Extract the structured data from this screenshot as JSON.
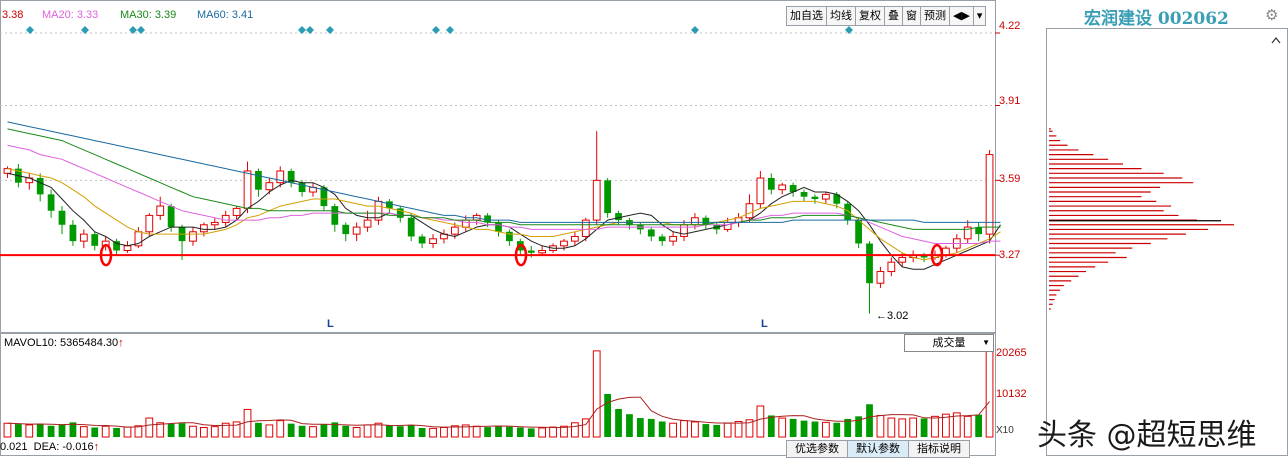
{
  "stock": {
    "name": "宏润建设 002062"
  },
  "toolbar": {
    "items": [
      "加自选",
      "均线",
      "复权",
      "叠",
      "窗",
      "预测",
      "◀▶",
      "▾"
    ]
  },
  "ma_labels": [
    {
      "text": "3.38",
      "color": "#cc0000"
    },
    {
      "text": "MA20: 3.33",
      "color": "#e060e0"
    },
    {
      "text": "MA30: 3.39",
      "color": "#1a8a1a"
    },
    {
      "text": "MA60: 3.41",
      "color": "#1a6aa0"
    }
  ],
  "chart_data": {
    "type": "candlestick",
    "price_ticks": [
      "4.22",
      "3.91",
      "3.59",
      "3.27"
    ],
    "ylim": [
      2.95,
      4.25
    ],
    "support_line": 3.27,
    "low_annotation": "3.02",
    "l_labels": [
      "L",
      "L"
    ],
    "candles": [
      [
        3.62,
        3.64,
        3.6,
        3.65
      ],
      [
        3.64,
        3.58,
        3.56,
        3.66
      ],
      [
        3.58,
        3.6,
        3.55,
        3.62
      ],
      [
        3.6,
        3.53,
        3.5,
        3.62
      ],
      [
        3.53,
        3.46,
        3.43,
        3.55
      ],
      [
        3.46,
        3.4,
        3.36,
        3.48
      ],
      [
        3.4,
        3.33,
        3.31,
        3.42
      ],
      [
        3.33,
        3.36,
        3.3,
        3.38
      ],
      [
        3.36,
        3.31,
        3.29,
        3.37
      ],
      [
        3.31,
        3.33,
        3.29,
        3.35
      ],
      [
        3.33,
        3.29,
        3.27,
        3.34
      ],
      [
        3.29,
        3.31,
        3.28,
        3.33
      ],
      [
        3.31,
        3.37,
        3.3,
        3.39
      ],
      [
        3.37,
        3.44,
        3.35,
        3.45
      ],
      [
        3.44,
        3.48,
        3.42,
        3.52
      ],
      [
        3.48,
        3.39,
        3.37,
        3.49
      ],
      [
        3.39,
        3.33,
        3.25,
        3.4
      ],
      [
        3.33,
        3.37,
        3.31,
        3.39
      ],
      [
        3.37,
        3.4,
        3.35,
        3.41
      ],
      [
        3.4,
        3.41,
        3.38,
        3.43
      ],
      [
        3.41,
        3.44,
        3.39,
        3.46
      ],
      [
        3.44,
        3.47,
        3.42,
        3.48
      ],
      [
        3.47,
        3.63,
        3.45,
        3.67
      ],
      [
        3.63,
        3.55,
        3.52,
        3.64
      ],
      [
        3.55,
        3.58,
        3.53,
        3.6
      ],
      [
        3.58,
        3.63,
        3.56,
        3.65
      ],
      [
        3.63,
        3.58,
        3.56,
        3.64
      ],
      [
        3.58,
        3.54,
        3.52,
        3.59
      ],
      [
        3.54,
        3.56,
        3.52,
        3.58
      ],
      [
        3.56,
        3.48,
        3.46,
        3.57
      ],
      [
        3.48,
        3.4,
        3.37,
        3.49
      ],
      [
        3.4,
        3.36,
        3.33,
        3.41
      ],
      [
        3.36,
        3.39,
        3.33,
        3.41
      ],
      [
        3.39,
        3.42,
        3.37,
        3.46
      ],
      [
        3.42,
        3.5,
        3.4,
        3.52
      ],
      [
        3.5,
        3.47,
        3.45,
        3.51
      ],
      [
        3.47,
        3.43,
        3.41,
        3.48
      ],
      [
        3.43,
        3.35,
        3.33,
        3.45
      ],
      [
        3.35,
        3.32,
        3.3,
        3.36
      ],
      [
        3.32,
        3.34,
        3.3,
        3.36
      ],
      [
        3.34,
        3.36,
        3.32,
        3.38
      ],
      [
        3.36,
        3.39,
        3.34,
        3.41
      ],
      [
        3.39,
        3.42,
        3.37,
        3.44
      ],
      [
        3.42,
        3.44,
        3.4,
        3.45
      ],
      [
        3.44,
        3.41,
        3.39,
        3.45
      ],
      [
        3.41,
        3.37,
        3.35,
        3.42
      ],
      [
        3.37,
        3.33,
        3.31,
        3.38
      ],
      [
        3.33,
        3.29,
        3.27,
        3.34
      ],
      [
        3.29,
        3.28,
        3.26,
        3.31
      ],
      [
        3.28,
        3.29,
        3.27,
        3.31
      ],
      [
        3.29,
        3.31,
        3.28,
        3.32
      ],
      [
        3.31,
        3.33,
        3.29,
        3.34
      ],
      [
        3.33,
        3.35,
        3.31,
        3.37
      ],
      [
        3.35,
        3.42,
        3.33,
        3.43
      ],
      [
        3.42,
        3.59,
        3.4,
        3.8
      ],
      [
        3.59,
        3.45,
        3.43,
        3.6
      ],
      [
        3.45,
        3.42,
        3.4,
        3.46
      ],
      [
        3.42,
        3.4,
        3.38,
        3.43
      ],
      [
        3.4,
        3.38,
        3.36,
        3.41
      ],
      [
        3.38,
        3.35,
        3.33,
        3.39
      ],
      [
        3.35,
        3.33,
        3.31,
        3.36
      ],
      [
        3.33,
        3.35,
        3.31,
        3.37
      ],
      [
        3.35,
        3.4,
        3.33,
        3.42
      ],
      [
        3.4,
        3.43,
        3.38,
        3.45
      ],
      [
        3.43,
        3.4,
        3.38,
        3.44
      ],
      [
        3.4,
        3.38,
        3.36,
        3.41
      ],
      [
        3.38,
        3.41,
        3.37,
        3.43
      ],
      [
        3.41,
        3.43,
        3.39,
        3.45
      ],
      [
        3.43,
        3.49,
        3.41,
        3.53
      ],
      [
        3.49,
        3.6,
        3.47,
        3.63
      ],
      [
        3.6,
        3.55,
        3.53,
        3.62
      ],
      [
        3.55,
        3.57,
        3.53,
        3.58
      ],
      [
        3.57,
        3.54,
        3.52,
        3.58
      ],
      [
        3.54,
        3.52,
        3.5,
        3.55
      ],
      [
        3.52,
        3.51,
        3.49,
        3.53
      ],
      [
        3.51,
        3.53,
        3.49,
        3.54
      ],
      [
        3.53,
        3.49,
        3.47,
        3.54
      ],
      [
        3.49,
        3.42,
        3.4,
        3.5
      ],
      [
        3.42,
        3.32,
        3.3,
        3.43
      ],
      [
        3.32,
        3.15,
        3.02,
        3.33
      ],
      [
        3.15,
        3.2,
        3.13,
        3.22
      ],
      [
        3.2,
        3.24,
        3.18,
        3.26
      ],
      [
        3.24,
        3.26,
        3.22,
        3.28
      ],
      [
        3.26,
        3.27,
        3.24,
        3.29
      ],
      [
        3.27,
        3.26,
        3.24,
        3.28
      ],
      [
        3.26,
        3.27,
        3.25,
        3.29
      ],
      [
        3.27,
        3.3,
        3.26,
        3.31
      ],
      [
        3.3,
        3.34,
        3.28,
        3.36
      ],
      [
        3.34,
        3.39,
        3.32,
        3.42
      ],
      [
        3.39,
        3.36,
        3.33,
        3.41
      ],
      [
        3.36,
        3.7,
        3.32,
        3.72
      ]
    ],
    "ma_series": {
      "MA5": [
        3.62,
        3.61,
        3.6,
        3.58,
        3.56,
        3.51,
        3.46,
        3.42,
        3.37,
        3.35,
        3.32,
        3.31,
        3.32,
        3.35,
        3.37,
        3.39,
        3.39,
        3.39,
        3.38,
        3.38,
        3.39,
        3.42,
        3.47,
        3.5,
        3.54,
        3.57,
        3.59,
        3.58,
        3.58,
        3.56,
        3.53,
        3.47,
        3.44,
        3.43,
        3.43,
        3.45,
        3.44,
        3.44,
        3.41,
        3.38,
        3.36,
        3.35,
        3.37,
        3.39,
        3.4,
        3.4,
        3.39,
        3.36,
        3.33,
        3.31,
        3.3,
        3.3,
        3.31,
        3.34,
        3.38,
        3.42,
        3.43,
        3.44,
        3.45,
        3.44,
        3.4,
        3.37,
        3.36,
        3.37,
        3.38,
        3.39,
        3.4,
        3.41,
        3.42,
        3.45,
        3.49,
        3.52,
        3.54,
        3.56,
        3.54,
        3.54,
        3.53,
        3.5,
        3.46,
        3.4,
        3.33,
        3.27,
        3.22,
        3.21,
        3.21,
        3.23,
        3.25,
        3.27,
        3.29,
        3.31,
        3.33,
        3.4
      ],
      "MA10": [
        3.64,
        3.63,
        3.62,
        3.61,
        3.6,
        3.58,
        3.55,
        3.52,
        3.48,
        3.45,
        3.42,
        3.39,
        3.37,
        3.36,
        3.36,
        3.36,
        3.36,
        3.36,
        3.36,
        3.37,
        3.38,
        3.4,
        3.43,
        3.44,
        3.46,
        3.48,
        3.49,
        3.5,
        3.51,
        3.51,
        3.51,
        3.5,
        3.49,
        3.48,
        3.48,
        3.47,
        3.46,
        3.45,
        3.43,
        3.42,
        3.41,
        3.4,
        3.39,
        3.38,
        3.38,
        3.37,
        3.36,
        3.36,
        3.35,
        3.35,
        3.35,
        3.36,
        3.37,
        3.38,
        3.39,
        3.4,
        3.41,
        3.41,
        3.41,
        3.41,
        3.41,
        3.4,
        3.4,
        3.4,
        3.4,
        3.41,
        3.42,
        3.43,
        3.45,
        3.47,
        3.48,
        3.49,
        3.5,
        3.5,
        3.5,
        3.49,
        3.48,
        3.46,
        3.42,
        3.38,
        3.34,
        3.31,
        3.28,
        3.26,
        3.25,
        3.26,
        3.27,
        3.28,
        3.3,
        3.32,
        3.34,
        3.37
      ],
      "MA20": [
        3.74,
        3.73,
        3.72,
        3.7,
        3.69,
        3.68,
        3.66,
        3.64,
        3.62,
        3.6,
        3.58,
        3.56,
        3.54,
        3.52,
        3.5,
        3.48,
        3.46,
        3.45,
        3.44,
        3.43,
        3.42,
        3.42,
        3.42,
        3.42,
        3.43,
        3.43,
        3.44,
        3.44,
        3.45,
        3.45,
        3.45,
        3.45,
        3.45,
        3.45,
        3.45,
        3.45,
        3.44,
        3.44,
        3.43,
        3.43,
        3.42,
        3.42,
        3.41,
        3.41,
        3.4,
        3.4,
        3.39,
        3.39,
        3.38,
        3.38,
        3.38,
        3.38,
        3.38,
        3.38,
        3.38,
        3.39,
        3.39,
        3.39,
        3.39,
        3.39,
        3.39,
        3.39,
        3.39,
        3.39,
        3.4,
        3.4,
        3.4,
        3.41,
        3.42,
        3.43,
        3.44,
        3.44,
        3.45,
        3.45,
        3.45,
        3.45,
        3.45,
        3.44,
        3.43,
        3.41,
        3.39,
        3.37,
        3.35,
        3.34,
        3.33,
        3.32,
        3.32,
        3.32,
        3.32,
        3.32,
        3.33,
        3.33
      ],
      "MA30": [
        3.81,
        3.8,
        3.79,
        3.78,
        3.77,
        3.76,
        3.74,
        3.72,
        3.7,
        3.68,
        3.66,
        3.64,
        3.62,
        3.6,
        3.58,
        3.56,
        3.54,
        3.52,
        3.51,
        3.5,
        3.49,
        3.48,
        3.47,
        3.47,
        3.46,
        3.46,
        3.46,
        3.46,
        3.46,
        3.46,
        3.46,
        3.45,
        3.45,
        3.45,
        3.45,
        3.44,
        3.44,
        3.44,
        3.43,
        3.43,
        3.43,
        3.42,
        3.42,
        3.42,
        3.41,
        3.41,
        3.41,
        3.4,
        3.4,
        3.4,
        3.4,
        3.4,
        3.4,
        3.4,
        3.4,
        3.4,
        3.4,
        3.4,
        3.4,
        3.4,
        3.4,
        3.4,
        3.4,
        3.4,
        3.4,
        3.41,
        3.41,
        3.41,
        3.42,
        3.42,
        3.43,
        3.43,
        3.43,
        3.44,
        3.44,
        3.44,
        3.44,
        3.44,
        3.43,
        3.42,
        3.41,
        3.4,
        3.39,
        3.38,
        3.38,
        3.38,
        3.38,
        3.38,
        3.38,
        3.39,
        3.39,
        3.39
      ],
      "MA60": [
        3.84,
        3.83,
        3.82,
        3.81,
        3.8,
        3.79,
        3.78,
        3.77,
        3.76,
        3.75,
        3.74,
        3.73,
        3.72,
        3.71,
        3.7,
        3.69,
        3.68,
        3.67,
        3.66,
        3.65,
        3.64,
        3.63,
        3.62,
        3.61,
        3.6,
        3.59,
        3.58,
        3.57,
        3.56,
        3.55,
        3.54,
        3.53,
        3.52,
        3.51,
        3.5,
        3.49,
        3.48,
        3.47,
        3.46,
        3.45,
        3.44,
        3.44,
        3.43,
        3.43,
        3.42,
        3.42,
        3.42,
        3.41,
        3.41,
        3.41,
        3.41,
        3.41,
        3.41,
        3.41,
        3.41,
        3.41,
        3.41,
        3.41,
        3.41,
        3.41,
        3.41,
        3.41,
        3.41,
        3.41,
        3.41,
        3.41,
        3.41,
        3.41,
        3.41,
        3.41,
        3.41,
        3.41,
        3.42,
        3.42,
        3.42,
        3.42,
        3.42,
        3.42,
        3.42,
        3.42,
        3.42,
        3.42,
        3.42,
        3.42,
        3.41,
        3.41,
        3.41,
        3.41,
        3.41,
        3.41,
        3.41,
        3.41
      ]
    },
    "volumes": [
      3.2,
      3,
      2.8,
      3.1,
      2.6,
      2.9,
      3.4,
      2.4,
      2.2,
      2.5,
      2.1,
      2.3,
      2.6,
      4.4,
      3.3,
      3.1,
      3.2,
      2.5,
      2.2,
      2.4,
      3.2,
      3.5,
      6.4,
      3.3,
      2.8,
      3.8,
      3.1,
      2.6,
      2.4,
      3,
      3.4,
      2.6,
      2.2,
      2.8,
      3.2,
      2.7,
      2.5,
      2.7,
      2.1,
      2,
      2.2,
      2.6,
      2.8,
      2.5,
      2.3,
      2.6,
      2.4,
      2.2,
      2,
      2.1,
      2.3,
      2.5,
      3.3,
      4.2,
      20,
      10,
      6.5,
      5.3,
      4.4,
      4.2,
      3.6,
      3.2,
      3.8,
      3.5,
      3,
      2.8,
      3.2,
      3.6,
      4,
      7.2,
      5,
      4.4,
      4.2,
      3.8,
      3.6,
      3.4,
      3.3,
      4.2,
      4.8,
      7.6,
      5,
      4.4,
      4.2,
      4.4,
      4.3,
      4.8,
      5.3,
      5.6,
      4.8,
      5.2,
      20.2
    ],
    "volume_ticks": [
      "20265",
      "10132"
    ],
    "mavol_label": "MAVOL10: 5365484.30",
    "volume_multiplier": "X10",
    "macd_label": "0.021",
    "dea_label": "DEA: -0.016",
    "volume_profile": [
      {
        "price": 3.81,
        "w": 0.01
      },
      {
        "price": 3.8,
        "w": 0.02
      },
      {
        "price": 3.78,
        "w": 0.04
      },
      {
        "price": 3.76,
        "w": 0.06
      },
      {
        "price": 3.74,
        "w": 0.1
      },
      {
        "price": 3.72,
        "w": 0.16
      },
      {
        "price": 3.7,
        "w": 0.24
      },
      {
        "price": 3.68,
        "w": 0.32
      },
      {
        "price": 3.66,
        "w": 0.4
      },
      {
        "price": 3.64,
        "w": 0.5
      },
      {
        "price": 3.62,
        "w": 0.62
      },
      {
        "price": 3.6,
        "w": 0.72
      },
      {
        "price": 3.58,
        "w": 0.78
      },
      {
        "price": 3.56,
        "w": 0.6
      },
      {
        "price": 3.54,
        "w": 0.55
      },
      {
        "price": 3.52,
        "w": 0.5
      },
      {
        "price": 3.5,
        "w": 0.58
      },
      {
        "price": 3.48,
        "w": 0.66
      },
      {
        "price": 3.46,
        "w": 0.62
      },
      {
        "price": 3.44,
        "w": 0.7
      },
      {
        "price": 3.42,
        "w": 0.8
      },
      {
        "price": 3.4,
        "w": 1.0
      },
      {
        "price": 3.38,
        "w": 0.86
      },
      {
        "price": 3.36,
        "w": 0.74
      },
      {
        "price": 3.34,
        "w": 0.64
      },
      {
        "price": 3.32,
        "w": 0.55
      },
      {
        "price": 3.3,
        "w": 0.45
      },
      {
        "price": 3.28,
        "w": 0.36
      },
      {
        "price": 3.26,
        "w": 0.42
      },
      {
        "price": 3.24,
        "w": 0.32
      },
      {
        "price": 3.22,
        "w": 0.25
      },
      {
        "price": 3.2,
        "w": 0.2
      },
      {
        "price": 3.18,
        "w": 0.16
      },
      {
        "price": 3.16,
        "w": 0.12
      },
      {
        "price": 3.14,
        "w": 0.08
      },
      {
        "price": 3.12,
        "w": 0.06
      },
      {
        "price": 3.1,
        "w": 0.04
      },
      {
        "price": 3.08,
        "w": 0.03
      },
      {
        "price": 3.06,
        "w": 0.02
      },
      {
        "price": 3.04,
        "w": 0.01
      }
    ]
  },
  "volume_dropdown": "成交量",
  "tabs": [
    "优选参数",
    "默认参数",
    "指标说明"
  ],
  "watermark": "头条 @超短思维",
  "colors": {
    "up": "#e00000",
    "down": "#009a00",
    "support": "#ff0000",
    "grid": "#c0c0c0",
    "accent": "#3a9fb5"
  }
}
